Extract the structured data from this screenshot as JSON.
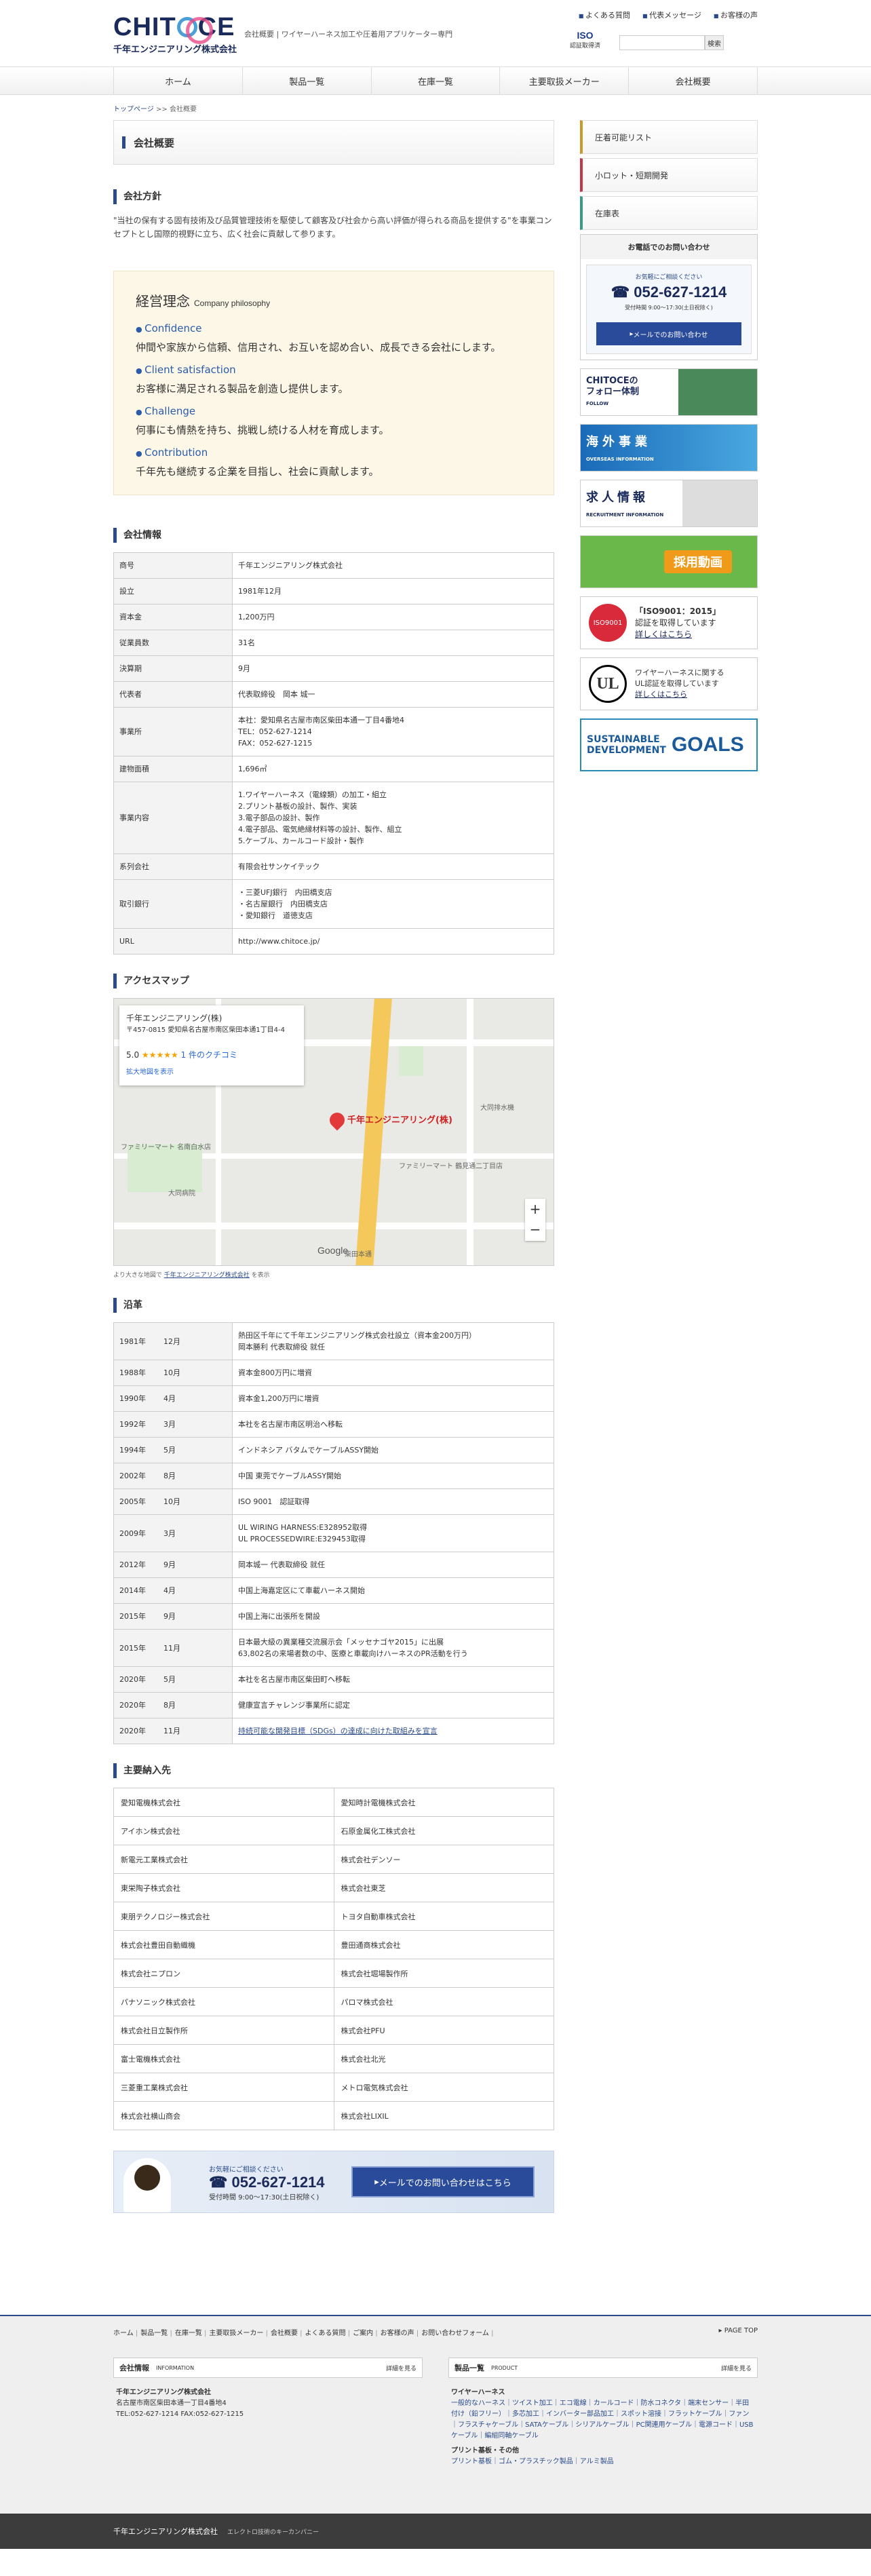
{
  "header": {
    "logo_text": "CHITOCE",
    "company_name": "千年エンジニアリング株式会社",
    "tagline": "会社概要 | ワイヤーハーネス加工や圧着用アプリケーター専門",
    "util_links": [
      "よくある質問",
      "代表メッセージ",
      "お客様の声"
    ],
    "iso_badge": "ISO",
    "iso_caption": "認証取得済",
    "search_button": "検索"
  },
  "gnav": [
    "ホーム",
    "製品一覧",
    "在庫一覧",
    "主要取扱メーカー",
    "会社概要"
  ],
  "breadcrumb": {
    "home": "トップページ",
    "sep": ">>",
    "current": "会社概要"
  },
  "page_title": "会社概要",
  "policy": {
    "heading": "会社方針",
    "text": "\"当社の保有する固有技術及び品質管理技術を駆使して顧客及び社会から高い評価が得られる商品を提供する\"を事業コンセプトとし国際的視野に立ち、広く社会に貢献して参ります。"
  },
  "philosophy": {
    "title": "経営理念",
    "title_en": "Company philosophy",
    "items": [
      {
        "en": "Confidence",
        "jp": "仲間や家族から信頼、信用され、お互いを認め合い、成長できる会社にします。"
      },
      {
        "en": "Client satisfaction",
        "jp": "お客様に満足される製品を創造し提供します。"
      },
      {
        "en": "Challenge",
        "jp": "何事にも情熱を持ち、挑戦し続ける人材を育成します。"
      },
      {
        "en": "Contribution",
        "jp": "千年先も継続する企業を目指し、社会に貢献します。"
      }
    ]
  },
  "company_info": {
    "heading": "会社情報",
    "rows": [
      {
        "k": "商号",
        "v": "千年エンジニアリング株式会社"
      },
      {
        "k": "設立",
        "v": "1981年12月"
      },
      {
        "k": "資本金",
        "v": "1,200万円"
      },
      {
        "k": "従業員数",
        "v": "31名"
      },
      {
        "k": "決算期",
        "v": "9月"
      },
      {
        "k": "代表者",
        "v": "代表取締役　岡本 城一"
      },
      {
        "k": "事業所",
        "v": "本社：愛知県名古屋市南区柴田本通一丁目4番地4\nTEL：052-627-1214\nFAX：052-627-1215"
      },
      {
        "k": "建物面積",
        "v": "1,696㎡"
      },
      {
        "k": "事業内容",
        "v": "1.ワイヤーハーネス（電線類）の加工・組立\n2.プリント基板の設計、製作、実装\n3.電子部品の設計、製作\n4.電子部品、電気絶縁材料等の設計、製作、組立\n5.ケーブル、カールコード設計・製作"
      },
      {
        "k": "系列会社",
        "v": "有限会社サンケイテック"
      },
      {
        "k": "取引銀行",
        "v": "・三菱UFJ銀行　内田橋支店\n・名古屋銀行　内田橋支店\n・愛知銀行　道徳支店"
      },
      {
        "k": "URL",
        "v": "http://www.chitoce.jp/"
      }
    ]
  },
  "access": {
    "heading": "アクセスマップ",
    "card_name": "千年エンジニアリング(株)",
    "card_address": "〒457-0815 愛知県名古屋市南区柴田本通1丁目4-4",
    "card_rating": "5.0",
    "card_stars": "★★★★★",
    "card_reviews": "1 件のクチコミ",
    "card_link": "拡大地図を表示",
    "pin_label": "千年エンジニアリング(株)",
    "map_labels": [
      "大同病院",
      "ファミリーマート 名南白水店",
      "柴田本通",
      "大同排水機",
      "ファミリーマート 鶴見通二丁目店",
      "Google"
    ],
    "zoom_in": "+",
    "zoom_out": "−",
    "note_prefix": "より大きな地図で",
    "note_link": "千年エンジニアリング株式会社",
    "note_suffix": "を表示"
  },
  "history": {
    "heading": "沿革",
    "rows": [
      {
        "y": "1981年",
        "m": "12月",
        "v": "熱田区千年にて千年エンジニアリング株式会社設立（資本金200万円）\n岡本勝利 代表取締役 就任"
      },
      {
        "y": "1988年",
        "m": "10月",
        "v": "資本金800万円に増資"
      },
      {
        "y": "1990年",
        "m": "4月",
        "v": "資本金1,200万円に増資"
      },
      {
        "y": "1992年",
        "m": "3月",
        "v": "本社を名古屋市南区明治へ移転"
      },
      {
        "y": "1994年",
        "m": "5月",
        "v": "インドネシア バタムでケーブルASSY開始"
      },
      {
        "y": "2002年",
        "m": "8月",
        "v": "中国 東莞でケーブルASSY開始"
      },
      {
        "y": "2005年",
        "m": "10月",
        "v": "ISO 9001　認証取得"
      },
      {
        "y": "2009年",
        "m": "3月",
        "v": "UL WIRING HARNESS:E328952取得\nUL PROCESSEDWIRE:E329453取得"
      },
      {
        "y": "2012年",
        "m": "9月",
        "v": "岡本城一 代表取締役 就任"
      },
      {
        "y": "2014年",
        "m": "4月",
        "v": "中国上海嘉定区にて車載ハーネス開始"
      },
      {
        "y": "2015年",
        "m": "9月",
        "v": "中国上海に出張所を開設"
      },
      {
        "y": "2015年",
        "m": "11月",
        "v": "日本最大級の異業種交流展示会「メッセナゴヤ2015」に出展\n63,802名の来場者数の中、医療と車載向けハーネスのPR活動を行う"
      },
      {
        "y": "2020年",
        "m": "5月",
        "v": "本社を名古屋市南区柴田町へ移転"
      },
      {
        "y": "2020年",
        "m": "8月",
        "v": "健康宣言チャレンジ事業所に認定"
      },
      {
        "y": "2020年",
        "m": "11月",
        "v": "持続可能な開発目標（SDGs）の達成に向けた取組みを宣言"
      }
    ]
  },
  "customers": {
    "heading": "主要納入先",
    "list": [
      "愛知電機株式会社",
      "愛知時計電機株式会社",
      "アイホン株式会社",
      "石原金属化工株式会社",
      "新電元工業株式会社",
      "株式会社デンソー",
      "東栄陶子株式会社",
      "株式会社東芝",
      "東朋テクノロジー株式会社",
      "トヨタ自動車株式会社",
      "株式会社豊田自動織機",
      "豊田通商株式会社",
      "株式会社ニプロン",
      "株式会社堀場製作所",
      "パナソニック株式会社",
      "パロマ株式会社",
      "株式会社日立製作所",
      "株式会社PFU",
      "富士電機株式会社",
      "株式会社北光",
      "三菱重工業株式会社",
      "メトロ電気株式会社",
      "株式会社横山商会",
      "株式会社LIXIL"
    ]
  },
  "contact_banner": {
    "small": "お気軽にご相談ください",
    "tel": "052-627-1214",
    "hours": "受付時間 9:00〜17:30(土日祝除く)",
    "button": "メールでのお問い合わせはこちら"
  },
  "sidebar": {
    "tabs": [
      "圧着可能リスト",
      "小ロット・短期開発",
      "在庫表"
    ],
    "contact_heading": "お電話でのお問い合わせ",
    "contact_small": "お気軽にご相談ください",
    "contact_tel": "052-627-1214",
    "contact_hours": "受付時間 9:00〜17:30(土日祝除く)",
    "contact_button": "メールでのお問い合わせ",
    "follow": "CHITOCEの\nフォロー体制",
    "follow_en": "FOLLOW",
    "overseas": "海外事業",
    "overseas_en": "OVERSEAS INFORMATION",
    "recruit": "求人情報",
    "recruit_en": "RECRUITMENT INFORMATION",
    "video": "採用動画",
    "iso_mark": "ISO9001",
    "iso_title": "「ISO9001：2015」",
    "iso_desc": "認証を取得しています",
    "iso_link": "詳しくはこちら",
    "ul_mark": "UL",
    "ul_desc": "ワイヤーハーネスに関する\nUL認証を取得しています",
    "ul_link": "詳しくはこちら",
    "sdg_text": "SUSTAINABLE\nDEVELOPMENT",
    "sdg_goals": "GOALS"
  },
  "footer": {
    "links": [
      "ホーム",
      "製品一覧",
      "在庫一覧",
      "主要取扱メーカー",
      "会社概要",
      "よくある質問",
      "ご案内",
      "お客様の声",
      "お問い合わせフォーム"
    ],
    "page_top": "PAGE TOP",
    "company": {
      "title": "会社情報",
      "en": "INFORMATION",
      "more": "詳細を見る",
      "name": "千年エンジニアリング株式会社",
      "addr": "名古屋市南区柴田本通一丁目4番地4",
      "tel": "TEL:052-627-1214 FAX:052-627-1215"
    },
    "products": {
      "title": "製品一覧",
      "en": "PRODUCT",
      "more": "詳細を見る",
      "cat1": "ワイヤーハーネス",
      "cat1_items": "一般的なハーネス｜ツイスト加工｜エコ電線｜カールコード｜防水コネクタ｜端末センサー｜半田付け（鉛フリー）｜多芯加工｜インバーター部品加工｜スポット溶接｜フラットケーブル｜ファン｜フラスチャケーブル｜SATAケーブル｜シリアルケーブル｜PC関連用ケーブル｜電源コード｜USBケーブル｜編組同軸ケーブル",
      "cat2": "プリント基板・その他",
      "cat2_items": "プリント基板｜ゴム・プラスチック製品｜アルミ製品"
    },
    "copyright": "千年エンジニアリング株式会社",
    "copyright_sub": "エレクトロ技術のキーカンパニー"
  }
}
